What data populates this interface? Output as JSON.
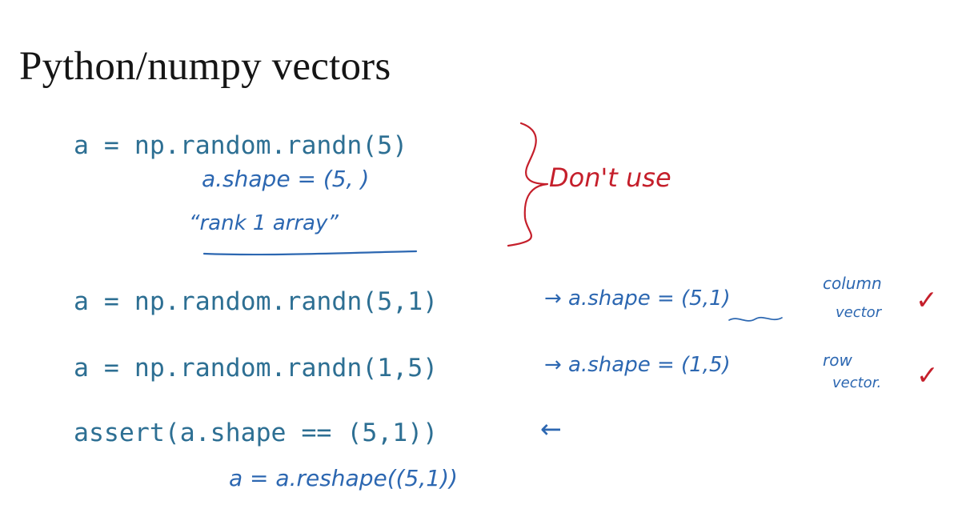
{
  "slide": {
    "title": "Python/numpy vectors",
    "code_lines": [
      "a = np.random.randn(5)",
      "a = np.random.randn(5,1)",
      "a = np.random.randn(1,5)",
      "assert(a.shape == (5,1))"
    ],
    "handwritten": {
      "shape_note_1": "a.shape = (5, )",
      "rank_note": "“rank 1 array”",
      "dont_use": "Don't use",
      "shape_note_2": "→ a.shape = (5,1)",
      "column_vector_1": "column",
      "column_vector_2": "vector",
      "shape_note_3": "→ a.shape = (1,5)",
      "row_vector_1": "row",
      "row_vector_2": "vector.",
      "assert_arrow": "←",
      "reshape_note": "a = a.reshape((5,1))",
      "checkmark": "✓"
    }
  },
  "colors": {
    "title": "#151515",
    "code": "#2d6f93",
    "blue_ink": "#2c67b1",
    "red_ink": "#c51f2b"
  }
}
